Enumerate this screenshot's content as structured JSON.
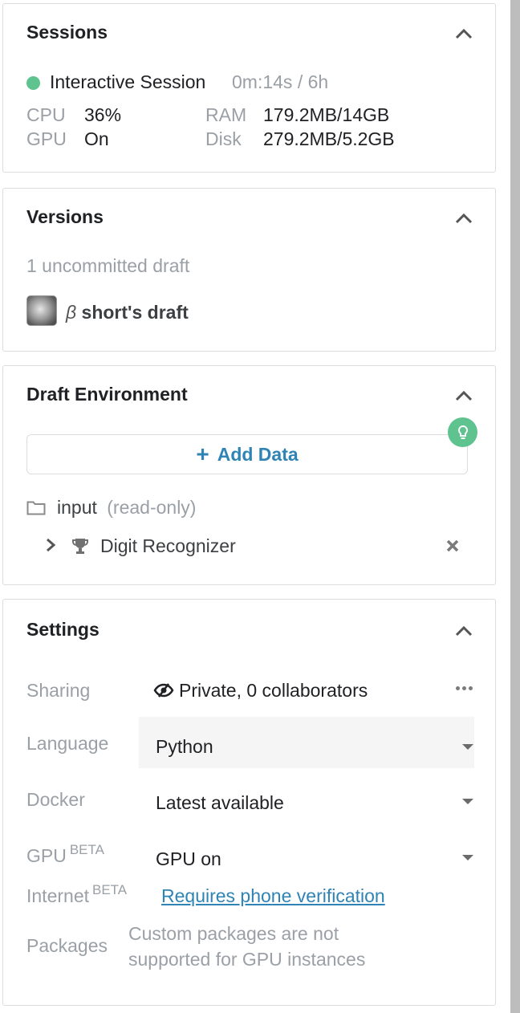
{
  "sessions": {
    "title": "Sessions",
    "session_name": "Interactive Session",
    "session_time": "0m:14s / 6h",
    "stats": {
      "cpu_label": "CPU",
      "cpu_value": "36%",
      "ram_label": "RAM",
      "ram_value": "179.2MB/14GB",
      "gpu_label": "GPU",
      "gpu_value": "On",
      "disk_label": "Disk",
      "disk_value": "279.2MB/5.2GB"
    },
    "status_color": "#5fc38f"
  },
  "versions": {
    "title": "Versions",
    "uncommitted": "1 uncommitted draft",
    "beta_symbol": "β",
    "draft_name": "short's draft"
  },
  "draft_environment": {
    "title": "Draft Environment",
    "add_data_label": "Add Data",
    "input_folder": "input",
    "input_note": "(read-only)",
    "dataset": "Digit Recognizer"
  },
  "settings": {
    "title": "Settings",
    "sharing_label": "Sharing",
    "sharing_value": "Private, 0 collaborators",
    "language_label": "Language",
    "language_value": "Python",
    "docker_label": "Docker",
    "docker_value": "Latest available",
    "gpu_label": "GPU",
    "gpu_beta": "BETA",
    "gpu_value": "GPU on",
    "internet_label": "Internet",
    "internet_beta": "BETA",
    "internet_value": "Requires phone verification",
    "packages_label": "Packages",
    "packages_line1": "Custom packages are not",
    "packages_line2": "supported for GPU instances"
  },
  "colors": {
    "accent": "#2f83b5",
    "success": "#5fc38f"
  },
  "icons": [
    "chevron-up-icon",
    "add-icon",
    "lightbulb-icon",
    "folder-icon",
    "chevron-right-icon",
    "trophy-icon",
    "close-icon",
    "private-eye-icon",
    "more-icon",
    "dropdown-caret-icon"
  ]
}
